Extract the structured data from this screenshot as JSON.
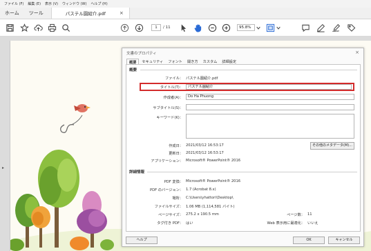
{
  "menubar": {
    "items": [
      "ファイル (F)",
      "編集 (E)",
      "表示 (V)",
      "ウィンドウ (W)",
      "ヘルプ (H)"
    ]
  },
  "tabs": {
    "home": "ホーム",
    "tools": "ツール",
    "document": "パステル園紹介.pdf",
    "close_glyph": "×"
  },
  "toolbar": {
    "page_current": "1",
    "page_total": "/ 11",
    "zoom_value": "95.8%"
  },
  "dialog": {
    "title": "文書のプロパティ",
    "close_glyph": "×",
    "tabs": [
      "概要",
      "セキュリティ",
      "フォント",
      "開き方",
      "カスタム",
      "詳細設定"
    ],
    "summary": {
      "heading": "概要",
      "file_label": "ファイル：",
      "file_value": "パステル園紹介.pdf",
      "title_label": "タイトル(T)：",
      "title_value": "パステル園紹介",
      "author_label": "作成者(A)：",
      "author_value": "Do Ha Phuong",
      "subtitle_label": "サブタイトル(S)：",
      "subtitle_value": "",
      "keywords_label": "キーワード(K)：",
      "keywords_value": "",
      "created_label": "作成日：",
      "created_value": "2021/03/12 16:53:17",
      "modified_label": "更新日：",
      "modified_value": "2021/03/12 16:53:17",
      "application_label": "アプリケーション：",
      "application_value": "Microsoft® PowerPoint® 2016",
      "metadata_button": "その他のメタデータ(M)..."
    },
    "details": {
      "heading": "詳細情報",
      "pdf_producer_label": "PDF 変換：",
      "pdf_producer_value": "Microsoft® PowerPoint® 2016",
      "pdf_version_label": "PDF のバージョン：",
      "pdf_version_value": "1.7 (Acrobat 8.x)",
      "location_label": "場所：",
      "location_value": "C:\\Users\\yhattori\\Desktop\\",
      "file_size_label": "ファイルサイズ：",
      "file_size_value": "1.06 MB (1,114,581 バイト)",
      "page_size_label": "ページサイズ：",
      "page_size_value": "275.2 x 190.5 mm",
      "page_count_label": "ページ数：",
      "page_count_value": "11",
      "tagged_label": "タグ付き PDF：",
      "tagged_value": "はい",
      "fast_web_label": "Web 表示用に最適化：",
      "fast_web_value": "いいえ"
    },
    "footer": {
      "help": "ヘルプ",
      "ok": "OK",
      "cancel": "キャンセル"
    }
  },
  "icons": {
    "save": "save-icon",
    "bookmark": "star-icon",
    "upload": "cloud-upload-icon",
    "print": "print-icon",
    "search": "search-icon",
    "prev_page": "arrow-up-circle-icon",
    "next_page": "arrow-down-circle-icon",
    "select": "pointer-icon",
    "hand": "hand-icon",
    "zoom_out": "zoom-out-icon",
    "zoom_in": "zoom-in-icon",
    "zoom_dropdown": "chevron-down-icon",
    "fit": "fit-page-icon",
    "comment": "comment-icon",
    "highlight": "pen-icon",
    "sign": "sign-icon",
    "share": "tag-icon"
  },
  "colors": {
    "highlight_box": "#d32b2b",
    "toolbar_icon": "#444444",
    "hand_tool_active": "#2a6bd6"
  }
}
